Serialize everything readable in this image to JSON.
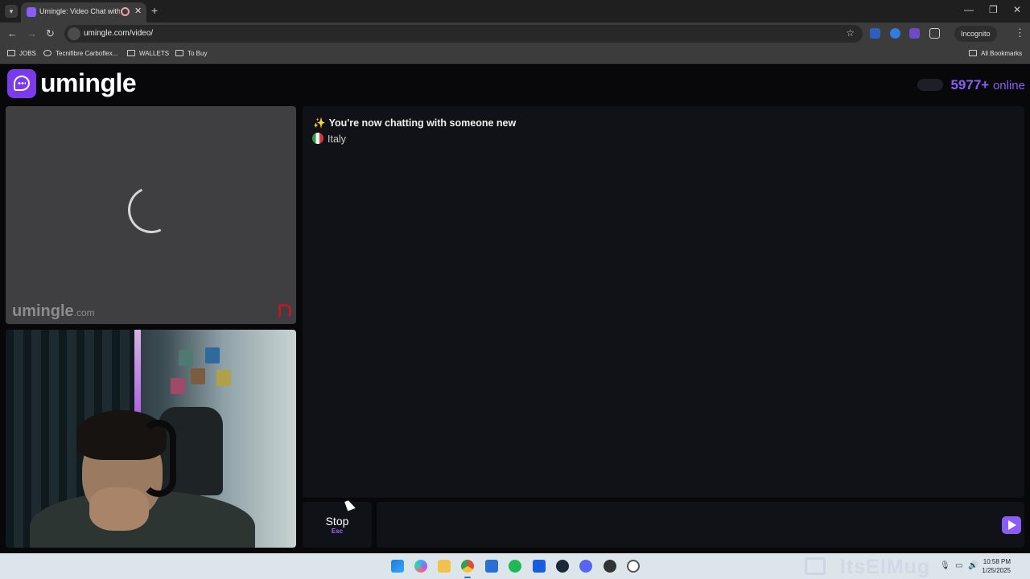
{
  "browser": {
    "tab_title": "Umingle: Video Chat with S",
    "close_symbol": "✕",
    "new_tab_symbol": "+",
    "url": "umingle.com/video/",
    "incognito_label": "Incognito",
    "bookmarks": [
      "JOBS",
      "Tecnifibre Carboflex...",
      "WALLETS",
      "To Buy"
    ],
    "all_bookmarks_label": "All Bookmarks",
    "icons": [
      "tab-search-icon",
      "back-arrow-icon",
      "forward-arrow-icon",
      "reload-icon",
      "star-icon",
      "extensions-icon",
      "kebab-menu-icon"
    ]
  },
  "site": {
    "logo_text": "umingle",
    "online_count": "5977+",
    "online_label": "online",
    "watermark": "umingle",
    "watermark_suffix": ".com",
    "chat": {
      "status_message": "You're now chatting with someone new",
      "country": "Italy"
    },
    "stop_label": "Stop",
    "stop_shortcut": "Esc",
    "message_input_value": "",
    "colors": {
      "accent": "#8b5cf6",
      "background": "#08080b",
      "panel": "#111217"
    }
  },
  "taskbar": {
    "time": "10:58 PM",
    "date": "1/25/2025",
    "apps": [
      "start-icon",
      "copilot-icon",
      "file-explorer-icon",
      "chrome-icon",
      "store-icon",
      "spotify-icon",
      "bitwarden-icon",
      "steam-icon",
      "discord-icon",
      "game-icon",
      "settings-icon"
    ],
    "stream_watermark": "ItsElMug"
  }
}
